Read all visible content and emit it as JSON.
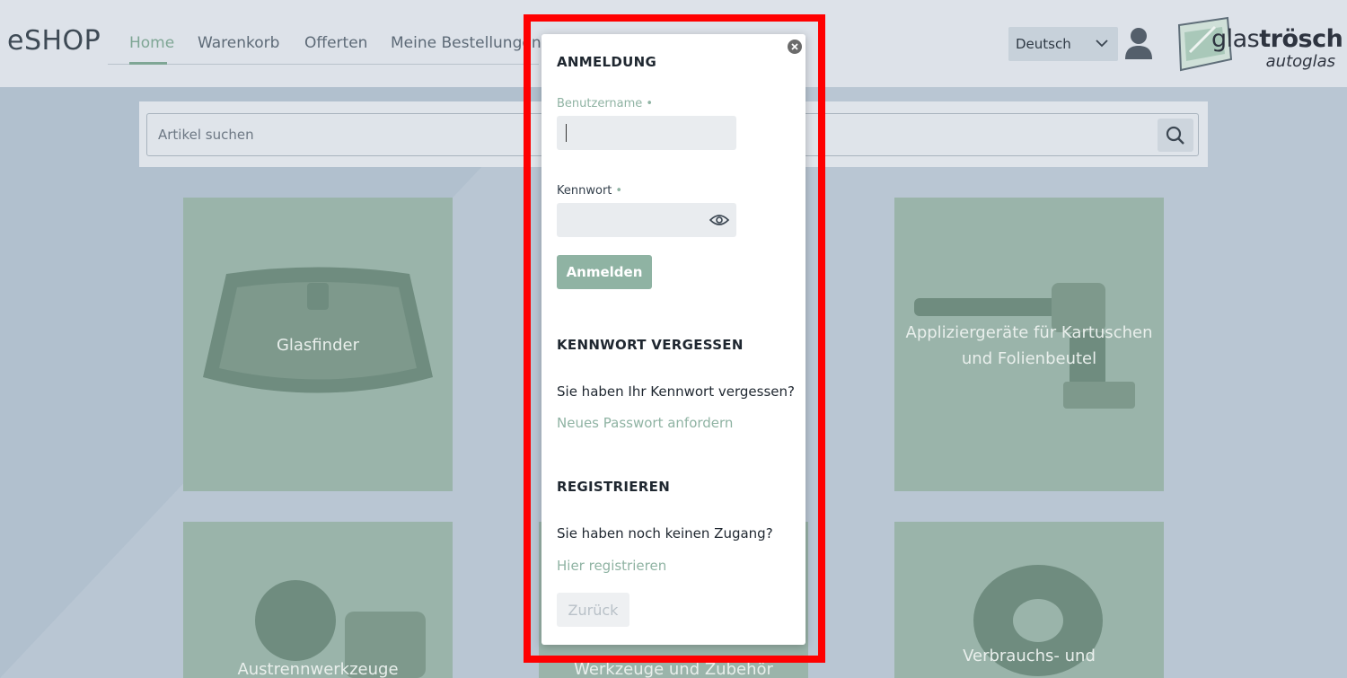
{
  "header": {
    "brand": "eSHOP",
    "nav": [
      "Home",
      "Warenkorb",
      "Offerten",
      "Meine Bestellungen"
    ],
    "active_nav": "Home",
    "language": "Deutsch",
    "logo_line1_regular": "glas",
    "logo_line1_bold": "trösch",
    "logo_line2": "autoglas"
  },
  "search": {
    "placeholder": "Artikel suchen"
  },
  "tiles": [
    {
      "label": "Glasfinder"
    },
    {
      "label": "Appliziergeräte für Kartuschen und Folienbeutel"
    },
    {
      "label": "Austrennwerkzeuge"
    },
    {
      "label": "Werkzeuge und Zubehör"
    },
    {
      "label": "Verbrauchs- und"
    }
  ],
  "dialog": {
    "login_title": "ANMELDUNG",
    "username_label": "Benutzername",
    "password_label": "Kennwort",
    "required_mark": "•",
    "login_button": "Anmelden",
    "forgot_title": "KENNWORT VERGESSEN",
    "forgot_text": "Sie haben Ihr Kennwort vergessen?",
    "forgot_link": "Neues Passwort anfordern",
    "register_title": "REGISTRIEREN",
    "register_text": "Sie haben noch keinen Zugang?",
    "register_link": "Hier registrieren",
    "back_button": "Zurück"
  },
  "colors": {
    "accent": "#8fb3a3",
    "highlight": "#ff0000",
    "tile": "#9ab4aa"
  }
}
